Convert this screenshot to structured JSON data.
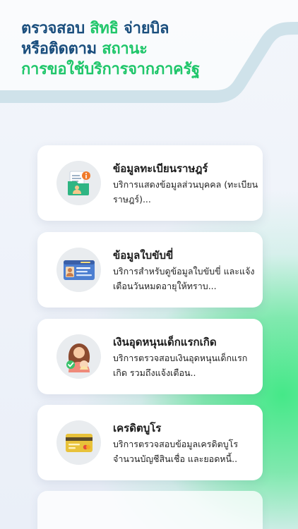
{
  "headline": {
    "line1_a": "ตรวจสอบ",
    "line1_b": "สิทธิ",
    "line1_c": "จ่ายบิล",
    "line2_a": "หรือติดตาม",
    "line2_b": "สถานะ",
    "line3": "การขอใช้บริการจากภาครัฐ"
  },
  "colors": {
    "brand_blue": "#1a4e7d",
    "brand_green": "#1fc66a",
    "band_teal": "#cfe2ea"
  },
  "services": [
    {
      "title": "ข้อมูลทะเบียนราษฎร์",
      "description": "บริการแสดงข้อมูลส่วนบุคคล (ทะเบียนราษฎร์)...",
      "icon": "document-folder-icon"
    },
    {
      "title": "ข้อมูลใบขับขี่",
      "description": "บริการสำหรับดูข้อมูลใบขับขี่ และแจ้งเตือนวันหมดอายุให้ทราบ...",
      "icon": "driver-license-icon"
    },
    {
      "title": "เงินอุดหนุนเด็กแรกเกิด",
      "description": "บริการตรวจสอบเงินอุดหนุนเด็กแรกเกิด รวมถึงแจ้งเตือน..",
      "icon": "mother-baby-icon"
    },
    {
      "title": "เครดิตบูโร",
      "description": "บริการตรวจสอบข้อมูลเครดิตบูโร จำนวนบัญชีสินเชื่อ และยอดหนี้..",
      "icon": "credit-card-icon"
    }
  ]
}
